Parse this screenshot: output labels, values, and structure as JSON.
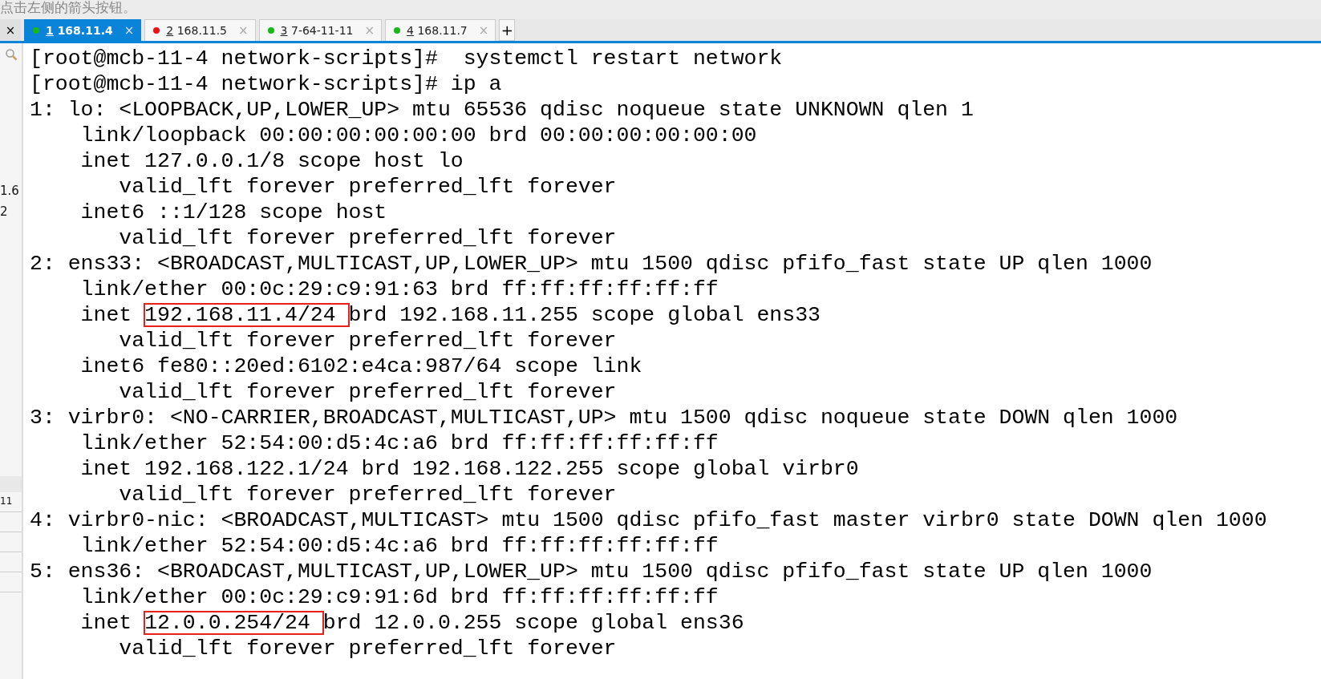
{
  "hint": "点击左侧的箭头按钮。",
  "close_all": "×",
  "tabs": [
    {
      "number": "1",
      "label": "168.11.4",
      "color": "#17b817",
      "selected": true,
      "close": "×"
    },
    {
      "number": "2",
      "label": "168.11.5",
      "color": "#ee1111",
      "selected": false,
      "close": "×"
    },
    {
      "number": "3",
      "label": "7-64-11-11",
      "color": "#17b817",
      "selected": false,
      "close": "×"
    },
    {
      "number": "4",
      "label": "168.11.7",
      "color": "#17b817",
      "selected": false,
      "close": "×"
    }
  ],
  "new_tab": "+",
  "sidebar": {
    "texts": [
      "1.6",
      "2"
    ],
    "list_text": "11"
  },
  "terminal": [
    [
      {
        "text": "[root@mcb-11-4 network-scripts]#  systemctl restart network"
      }
    ],
    [
      {
        "text": "[root@mcb-11-4 network-scripts]# ip a"
      }
    ],
    [
      {
        "text": "1: lo: <LOOPBACK,UP,LOWER_UP> mtu 65536 qdisc noqueue state UNKNOWN qlen 1"
      }
    ],
    [
      {
        "text": "    link/loopback 00:00:00:00:00:00 brd 00:00:00:00:00:00"
      }
    ],
    [
      {
        "text": "    inet 127.0.0.1/8 scope host lo"
      }
    ],
    [
      {
        "text": "       valid_lft forever preferred_lft forever"
      }
    ],
    [
      {
        "text": "    inet6 ::1/128 scope host"
      }
    ],
    [
      {
        "text": "       valid_lft forever preferred_lft forever"
      }
    ],
    [
      {
        "text": "2: ens33: <BROADCAST,MULTICAST,UP,LOWER_UP> mtu 1500 qdisc pfifo_fast state UP qlen 1000"
      }
    ],
    [
      {
        "text": "    link/ether 00:0c:29:c9:91:63 brd ff:ff:ff:ff:ff:ff"
      }
    ],
    [
      {
        "text": "    inet "
      },
      {
        "text": "192.168.11.4/24 ",
        "boxed": true
      },
      {
        "text": "brd 192.168.11.255 scope global ens33"
      }
    ],
    [
      {
        "text": "       valid_lft forever preferred_lft forever"
      }
    ],
    [
      {
        "text": "    inet6 fe80::20ed:6102:e4ca:987/64 scope link"
      }
    ],
    [
      {
        "text": "       valid_lft forever preferred_lft forever"
      }
    ],
    [
      {
        "text": "3: virbr0: <NO-CARRIER,BROADCAST,MULTICAST,UP> mtu 1500 qdisc noqueue state DOWN qlen 1000"
      }
    ],
    [
      {
        "text": "    link/ether 52:54:00:d5:4c:a6 brd ff:ff:ff:ff:ff:ff"
      }
    ],
    [
      {
        "text": "    inet 192.168.122.1/24 brd 192.168.122.255 scope global virbr0"
      }
    ],
    [
      {
        "text": "       valid_lft forever preferred_lft forever"
      }
    ],
    [
      {
        "text": "4: virbr0-nic: <BROADCAST,MULTICAST> mtu 1500 qdisc pfifo_fast master virbr0 state DOWN qlen 1000"
      }
    ],
    [
      {
        "text": "    link/ether 52:54:00:d5:4c:a6 brd ff:ff:ff:ff:ff:ff"
      }
    ],
    [
      {
        "text": "5: ens36: <BROADCAST,MULTICAST,UP,LOWER_UP> mtu 1500 qdisc pfifo_fast state UP qlen 1000"
      }
    ],
    [
      {
        "text": "    link/ether 00:0c:29:c9:91:6d brd ff:ff:ff:ff:ff:ff"
      }
    ],
    [
      {
        "text": "    inet "
      },
      {
        "text": "12.0.0.254/24 ",
        "boxed": true
      },
      {
        "text": "brd 12.0.0.255 scope global ens36"
      }
    ],
    [
      {
        "text": "       valid_lft forever preferred_lft forever"
      }
    ]
  ]
}
